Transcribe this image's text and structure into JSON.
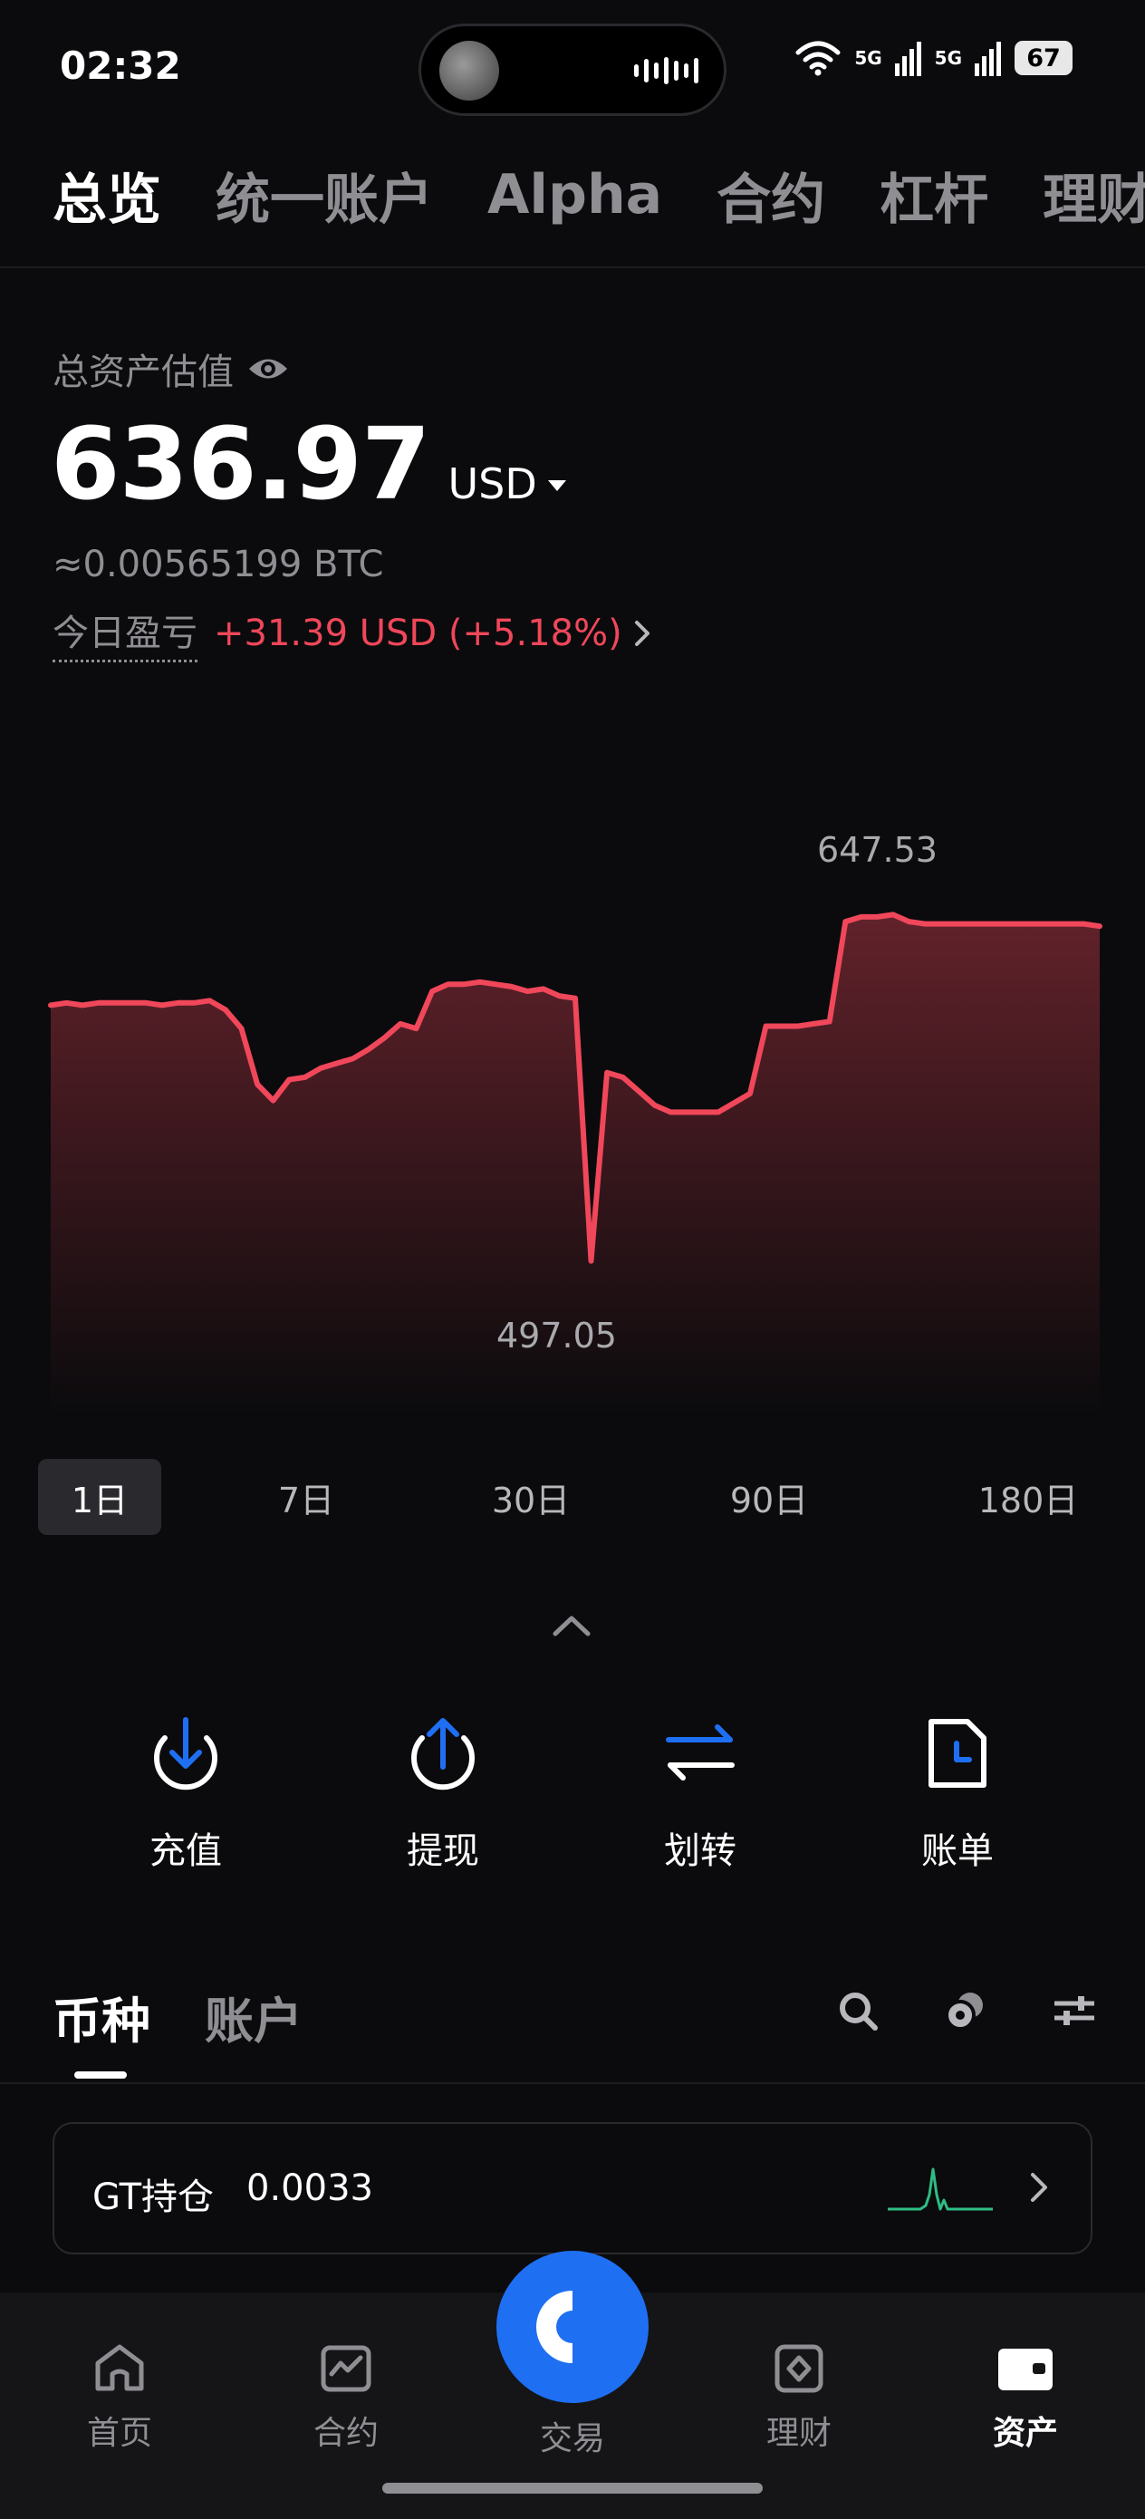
{
  "status_bar": {
    "time": "02:32",
    "net1": "5G",
    "net2": "5G",
    "battery": "67"
  },
  "top_tabs": [
    {
      "label": "总览",
      "active": true
    },
    {
      "label": "统一账户",
      "active": false
    },
    {
      "label": "Alpha",
      "active": false
    },
    {
      "label": "合约",
      "active": false
    },
    {
      "label": "杠杆",
      "active": false
    },
    {
      "label": "理财",
      "active": false
    }
  ],
  "asset": {
    "label": "总资产估值",
    "value": "636.97",
    "currency": "USD",
    "btc": "≈0.00565199 BTC",
    "pnl_label": "今日盈亏",
    "pnl_value": "+31.39 USD (+5.18%)"
  },
  "chart_data": {
    "type": "area",
    "color": "#f0475a",
    "max_label": "647.53",
    "min_label": "497.05",
    "ylim": [
      497.05,
      647.53
    ],
    "values": [
      608,
      609,
      608,
      609,
      609,
      609,
      609,
      608,
      609,
      609,
      610,
      606,
      598,
      574,
      567,
      576,
      577,
      581,
      583,
      585,
      589,
      594,
      600,
      598,
      614,
      617,
      617,
      618,
      617,
      616,
      614,
      615,
      612,
      611,
      498,
      579,
      577,
      571,
      565,
      562,
      562,
      562,
      562,
      566,
      570,
      599,
      599,
      599,
      600,
      601,
      644,
      646,
      646,
      647,
      644,
      643,
      643,
      643,
      643,
      643,
      643,
      643,
      643,
      643,
      643,
      643,
      642
    ]
  },
  "range_tabs": [
    {
      "label": "1日",
      "active": true
    },
    {
      "label": "7日",
      "active": false
    },
    {
      "label": "30日",
      "active": false
    },
    {
      "label": "90日",
      "active": false
    },
    {
      "label": "180日",
      "active": false
    }
  ],
  "actions": {
    "deposit": "充值",
    "withdraw": "提现",
    "transfer": "划转",
    "bill": "账单"
  },
  "asset_tabs": [
    {
      "label": "币种",
      "active": true
    },
    {
      "label": "账户",
      "active": false
    }
  ],
  "gt_holding": {
    "label": "GT持仓",
    "value": "0.0033"
  },
  "bottom_nav": {
    "home": "首页",
    "futures": "合约",
    "trade": "交易",
    "earn": "理财",
    "assets": "资产"
  },
  "colors": {
    "accent": "#1f6ff3",
    "loss_gain_red": "#f0475a",
    "spark_green": "#2ebd85"
  }
}
